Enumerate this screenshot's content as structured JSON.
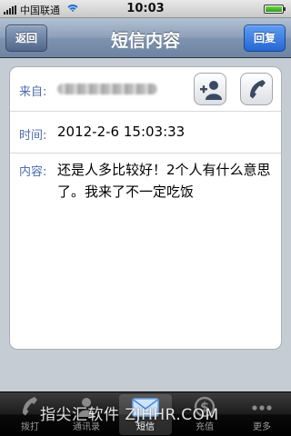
{
  "status_bar": {
    "carrier": "中国联通",
    "time": "10:03",
    "battery_level": 1.0,
    "wifi_color": "#1e6cd9"
  },
  "nav": {
    "back_label": "返回",
    "title": "短信内容",
    "reply_label": "回复"
  },
  "message": {
    "from_label": "来自:",
    "time_label": "时间:",
    "time_value": "2012-2-6 15:03:33",
    "content_label": "内容:",
    "content_value": "还是人多比较好！2个人有什么意思了。我来了不一定吃饭",
    "add_contact_icon": "add-contact-icon",
    "call_icon": "phone-icon"
  },
  "tabs": [
    {
      "label": "拨打",
      "icon": "phone-icon",
      "active": false
    },
    {
      "label": "通讯录",
      "icon": "contacts-icon",
      "active": false
    },
    {
      "label": "短信",
      "icon": "envelope-icon",
      "active": true
    },
    {
      "label": "充值",
      "icon": "recharge-icon",
      "active": false
    },
    {
      "label": "更多",
      "icon": "more-icon",
      "active": false
    }
  ],
  "watermark": "指尖汇软件  ZJHHR.COM",
  "colors": {
    "label": "#4d6cab",
    "nav_bar": "#8c9fb9",
    "reply_button": "#2467d3",
    "tab_bar": "#1c1c1c"
  }
}
